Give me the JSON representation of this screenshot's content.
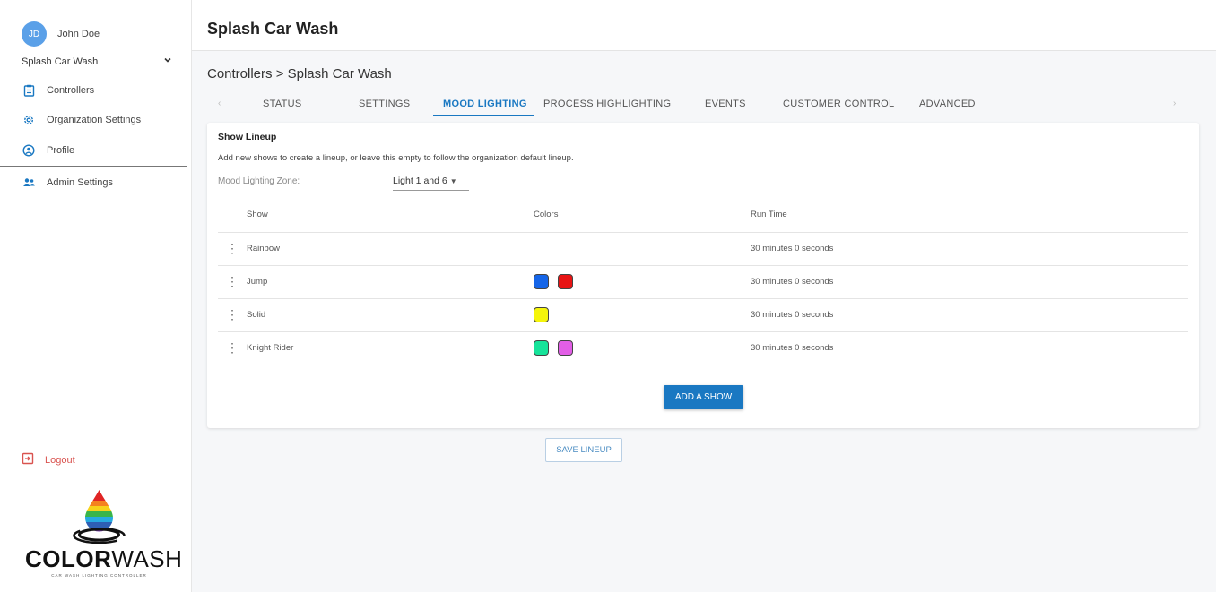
{
  "user": {
    "initials": "JD",
    "name": "John Doe"
  },
  "sidebar": {
    "org_select": "Splash Car Wash",
    "items": [
      {
        "label": "Controllers",
        "icon": "clipboard-icon"
      },
      {
        "label": "Organization Settings",
        "icon": "gear-icon"
      },
      {
        "label": "Profile",
        "icon": "user-circle-icon"
      },
      {
        "label": "Admin Settings",
        "icon": "users-icon"
      }
    ],
    "logout": "Logout"
  },
  "logo": {
    "text_bold": "COLOR",
    "text_regular": "WASH",
    "tagline": "CAR WASH LIGHTING CONTROLLER"
  },
  "header": {
    "title": "Splash Car Wash"
  },
  "breadcrumb": "Controllers > Splash Car Wash",
  "tabs": {
    "prev": "‹",
    "next": "›",
    "items": [
      "STATUS",
      "SETTINGS",
      "MOOD LIGHTING",
      "PROCESS HIGHLIGHTING",
      "EVENTS",
      "CUSTOMER CONTROL",
      "ADVANCED"
    ],
    "active": "MOOD LIGHTING"
  },
  "lineup": {
    "title": "Show Lineup",
    "description": "Add new shows to create a lineup, or leave this empty to follow the organization default lineup.",
    "zone_label": "Mood Lighting Zone:",
    "zone_value": "Light 1 and 6",
    "columns": {
      "show": "Show",
      "colors": "Colors",
      "run_time": "Run Time"
    },
    "rows": [
      {
        "show": "Rainbow",
        "colors": [],
        "run_time": "30 minutes 0 seconds"
      },
      {
        "show": "Jump",
        "colors": [
          "#1565e8",
          "#e81414"
        ],
        "run_time": "30 minutes 0 seconds"
      },
      {
        "show": "Solid",
        "colors": [
          "#f5f50a"
        ],
        "run_time": "30 minutes 0 seconds"
      },
      {
        "show": "Knight Rider",
        "colors": [
          "#16e39a",
          "#e25ee6"
        ],
        "run_time": "30 minutes 0 seconds"
      }
    ],
    "add_button": "ADD A SHOW",
    "save_button": "SAVE LINEUP"
  },
  "colors": {
    "accent": "#1a78c2",
    "logout": "#d9534f",
    "avatar": "#5aa0e8"
  }
}
